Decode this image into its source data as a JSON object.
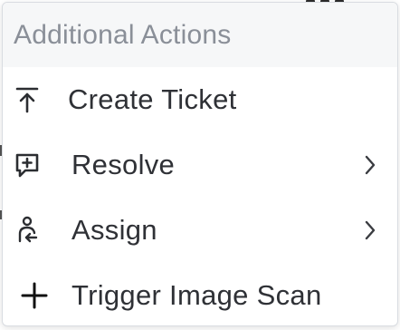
{
  "menu": {
    "header": "Additional Actions",
    "items": [
      {
        "label": "Create Ticket",
        "icon": "upload-arrow-icon",
        "has_submenu": false
      },
      {
        "label": "Resolve",
        "icon": "message-plus-icon",
        "has_submenu": true
      },
      {
        "label": "Assign",
        "icon": "user-assign-icon",
        "has_submenu": true
      },
      {
        "label": "Trigger Image Scan",
        "icon": "plus-icon",
        "has_submenu": false
      }
    ]
  },
  "colors": {
    "header_background": "#f6f7f8",
    "header_text": "#8a8f98",
    "item_text": "#2f3136",
    "icon": "#2b2d31",
    "border": "#d9dce1"
  }
}
